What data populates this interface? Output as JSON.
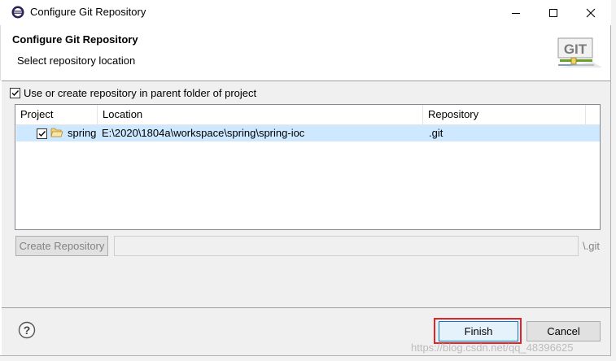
{
  "window": {
    "title": "Configure Git Repository"
  },
  "header": {
    "title": "Configure Git Repository",
    "subtitle": "Select repository location",
    "logo_text": "GIT"
  },
  "options": {
    "use_parent_label": "Use or create repository in parent folder of project",
    "use_parent_checked": true
  },
  "table": {
    "columns": [
      "Project",
      "Location",
      "Repository"
    ],
    "rows": [
      {
        "checked": true,
        "project": "spring",
        "location": "E:\\2020\\1804a\\workspace\\spring\\spring-ioc",
        "repository": ".git"
      }
    ]
  },
  "create": {
    "button_label": "Create Repository",
    "path_value": "",
    "suffix": "\\.git"
  },
  "footer": {
    "finish_label": "Finish",
    "cancel_label": "Cancel"
  },
  "watermark": "https://blog.csdn.net/qq_48396625",
  "colors": {
    "selection": "#cde8ff",
    "highlight_box": "#e0242a",
    "default_button_border": "#0078d7"
  },
  "icons": {
    "app": "eclipse-icon",
    "help": "help-icon",
    "folder": "folder-open-icon"
  }
}
